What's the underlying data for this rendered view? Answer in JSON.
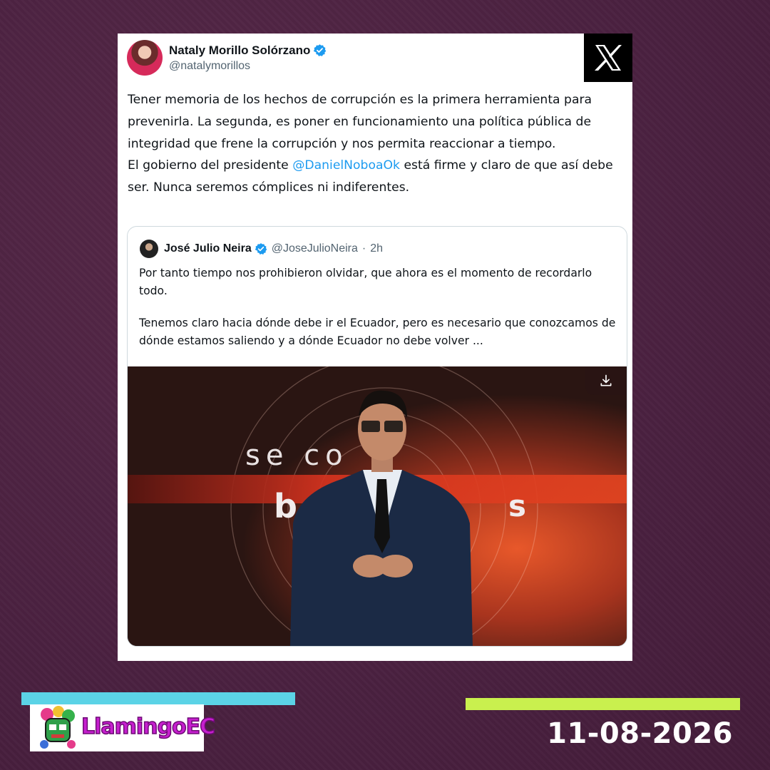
{
  "tweet": {
    "author_name": "Nataly Morillo Solórzano",
    "author_handle": "@natalymorillos",
    "text_line1": "Tener memoria de los hechos de corrupción es la primera herramienta para prevenirla. La segunda, es poner en funcionamiento una política pública de integridad que frene la corrupción y nos permita reaccionar a tiempo.",
    "text_line2_before": "El gobierno del presidente ",
    "mention": "@DanielNoboaOk",
    "text_line2_after": " está firme y claro de que así debe ser. Nunca seremos cómplices ni indiferentes."
  },
  "quote": {
    "author_name": "José Julio Neira",
    "author_handle": "@JoseJulioNeira",
    "separator": "·",
    "time": "2h",
    "paragraph1": "Por tanto tiempo nos prohibieron olvidar, que ahora es el momento de recordarlo todo.",
    "paragraph2": "Tenemos claro hacia dónde debe ir el Ecuador, pero es necesario que conozcamos de dónde estamos saliendo y a dónde Ecuador no debe volver ...",
    "media_text_top": "se co",
    "media_text_b": "b",
    "media_text_s": "s"
  },
  "footer": {
    "brand": "LlamingoEC",
    "date": "11-08-2026"
  },
  "colors": {
    "background": "#4d2340",
    "mention": "#1d9bf0",
    "verified": "#1d9bf0",
    "bar_cyan": "#5bd3e6",
    "bar_lime": "#c9f04e"
  }
}
